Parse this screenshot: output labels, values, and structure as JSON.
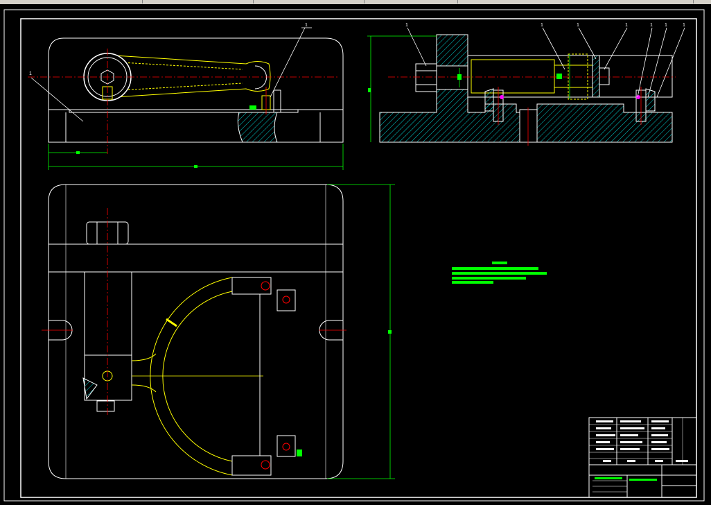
{
  "colors": {
    "background": "#000000",
    "outline": "#ffffff",
    "part_line": "#ffff00",
    "centerline": "#ff0000",
    "dimension": "#00ff00",
    "hatch": "#00ffff",
    "highlight": "#ff00ff",
    "toolbar": "#d4d0c8"
  },
  "icons": {
    "cylinder_rod": "cylinder-icon",
    "clamp_arm": "clamp-arm-icon",
    "hex_nut": "hex-nut-icon",
    "bolt_hole": "bolt-hole-icon"
  },
  "balloon_labels": [
    {
      "text": "1"
    },
    {
      "text": "1"
    },
    {
      "text": "1"
    },
    {
      "text": "1"
    },
    {
      "text": "1"
    },
    {
      "text": "1"
    },
    {
      "text": "1"
    },
    {
      "text": "1"
    },
    {
      "text": "1"
    }
  ],
  "title_block": {
    "cells": [
      "",
      "",
      "",
      "",
      "",
      ""
    ]
  }
}
